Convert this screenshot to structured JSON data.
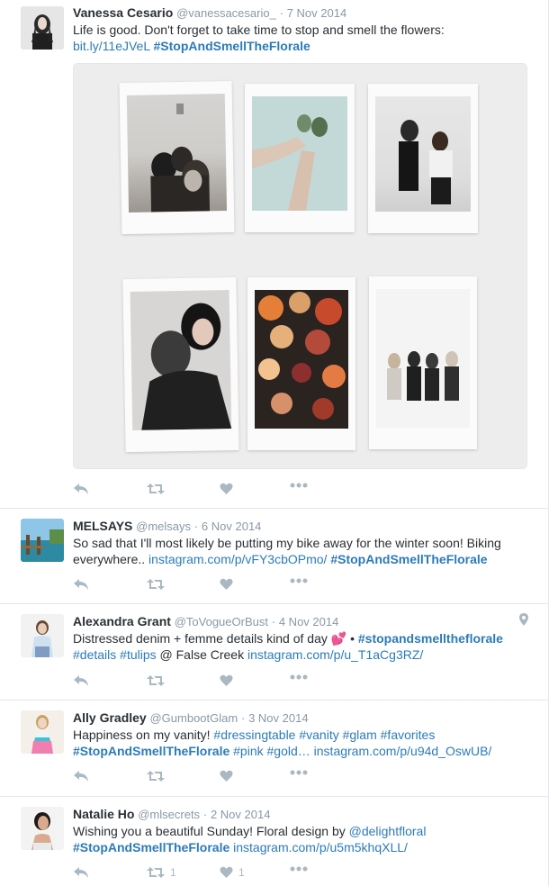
{
  "tweets": [
    {
      "fullname": "Vanessa Cesario",
      "handle": "@vanessacesario_",
      "separator": "·",
      "time": "7 Nov 2014",
      "text_plain": "Life is good. Don't forget to take time to stop and smell the flowers: ",
      "link": "bit.ly/11eJVeL",
      "hashtag": "#StopAndSmellTheFlorale"
    },
    {
      "fullname": "MELSAYS",
      "handle": "@melsays",
      "separator": "·",
      "time": "6 Nov 2014",
      "text_plain": "So sad that I'll most likely be putting my bike away for the winter soon! Biking everywhere.. ",
      "link": "instagram.com/p/vFY3cbOPmo/",
      "hashtag": "#StopAndSmellTheFlorale"
    },
    {
      "fullname": "Alexandra Grant",
      "handle": "@ToVogueOrBust",
      "separator": "·",
      "time": "4 Nov 2014",
      "text_plain": "Distressed denim + femme details kind of day ",
      "emoji": "💕",
      "bullet": " • ",
      "hashtag1": "#stopandsmelltheflorale",
      "hashtag2": "#details",
      "hashtag3": "#tulips",
      "text_plain2": " @ False Creek ",
      "link": "instagram.com/p/u_T1aCg3RZ/"
    },
    {
      "fullname": "Ally Gradley",
      "handle": "@GumbootGlam",
      "separator": "·",
      "time": "3 Nov 2014",
      "text_plain": "Happiness on my vanity! ",
      "hashtag1": "#dressingtable",
      "hashtag2": "#vanity",
      "hashtag3": "#glam",
      "hashtag4": "#favorites",
      "hashtag5": "#StopAndSmellTheFlorale",
      "hashtag6": "#pink",
      "hashtag7": "#gold…",
      "link": "instagram.com/p/u94d_OswUB/"
    },
    {
      "fullname": "Natalie Ho",
      "handle": "@mlsecrets",
      "separator": "·",
      "time": "2 Nov 2014",
      "text_plain": "Wishing you a beautiful Sunday! Floral design by ",
      "mention": "@delightfloral",
      "hashtag": "#StopAndSmellTheFlorale",
      "link": "instagram.com/p/u5m5khqXLL/",
      "retweet_count": "1",
      "like_count": "1"
    }
  ],
  "icons": {
    "reply": "reply-icon",
    "retweet": "retweet-icon",
    "like": "heart-icon",
    "more": "more-icon",
    "location": "location-pin-icon"
  },
  "colors": {
    "link": "#2b7bb9",
    "muted": "#8899a6",
    "action": "#aab8c2",
    "text": "#292f33",
    "divider": "#e1e8ed"
  }
}
